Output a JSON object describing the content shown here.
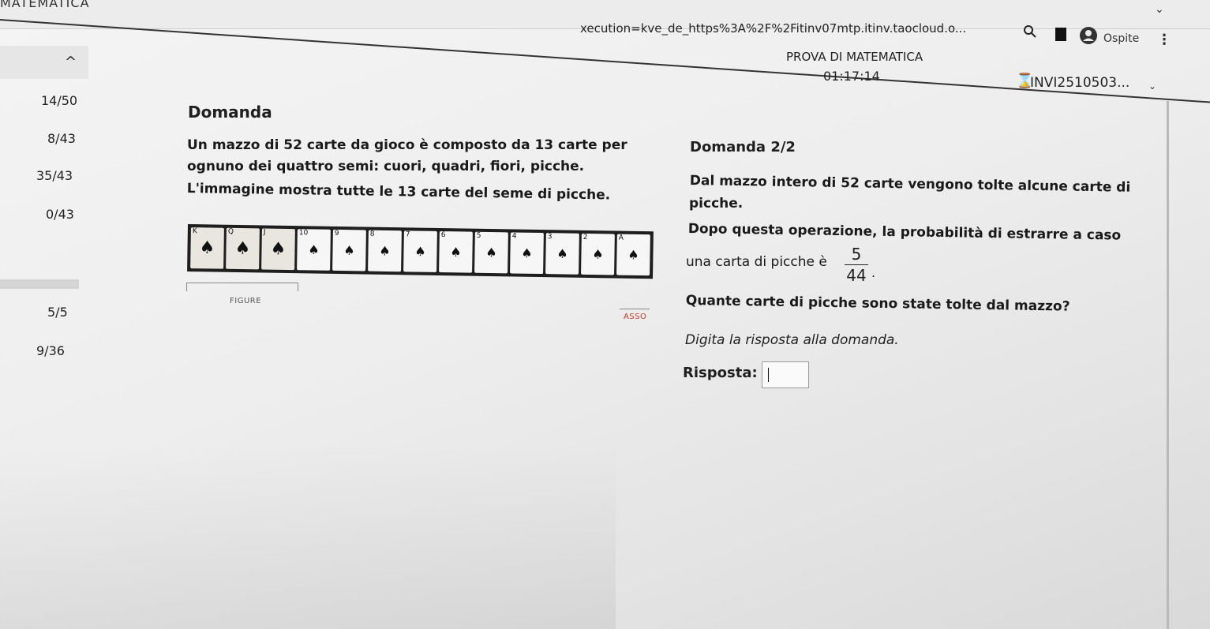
{
  "browser": {
    "tab_title": "MATEMATICA",
    "url": "xecution=kve_de_https%3A%2F%2Fitinv07mtp.itinv.taocloud.o...",
    "profile_label": "Ospite"
  },
  "header": {
    "collapse_glyph": "^",
    "test_title": "PROVA DI MATEMATICA",
    "timer": "01:17:14",
    "user_label": "INVI2510503..."
  },
  "sidebar": {
    "items": [
      "14/50",
      "8/43",
      "35/43",
      "0/43",
      "5/5",
      "9/36"
    ]
  },
  "stimulus": {
    "heading": "Domanda",
    "lines": [
      "Un mazzo di 52 carte da gioco è composto da 13 carte per",
      "ognuno dei quattro semi: cuori, quadri, fiori, picche.",
      "L'immagine mostra tutte le 13 carte del seme di picche."
    ],
    "figure_label": "FIGURE",
    "ace_label": "ASSO",
    "cards": [
      "K",
      "Q",
      "J",
      "10",
      "9",
      "8",
      "7",
      "6",
      "5",
      "4",
      "3",
      "2",
      "A"
    ]
  },
  "item": {
    "label": "Domanda 2/2",
    "line1": "Dal mazzo intero di 52 carte vengono tolte alcune carte di",
    "line2": "picche.",
    "line3": "Dopo questa operazione, la probabilità di estrarre a caso",
    "line4": "una carta di picche è",
    "fraction_num": "5",
    "fraction_den": "44",
    "fraction_end": ".",
    "question": "Quante carte di picche sono state tolte dal mazzo?",
    "instruction": "Digita la risposta alla domanda.",
    "answer_label": "Risposta:",
    "answer_value": ""
  }
}
